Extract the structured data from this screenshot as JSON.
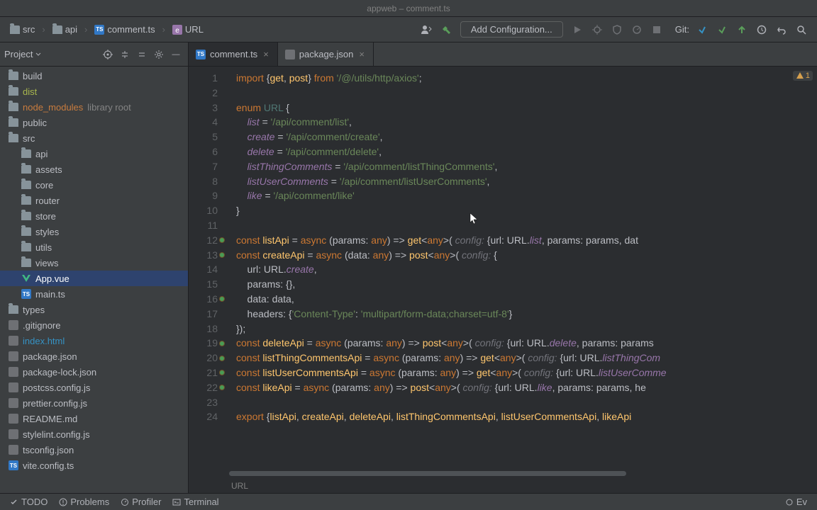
{
  "titlebar": "appweb – comment.ts",
  "breadcrumb": [
    {
      "label": "src",
      "icon": "folder"
    },
    {
      "label": "api",
      "icon": "folder"
    },
    {
      "label": "comment.ts",
      "icon": "ts"
    },
    {
      "label": "URL",
      "icon": "enum"
    }
  ],
  "config_label": "Add Configuration...",
  "git_label": "Git:",
  "project": {
    "title": "Project",
    "items": [
      {
        "label": "build",
        "icon": "folder",
        "indent": 0
      },
      {
        "label": "dist",
        "icon": "folder",
        "indent": 0,
        "cls": "olive"
      },
      {
        "label": "node_modules",
        "suffix": "library root",
        "icon": "folder",
        "indent": 0,
        "cls": "orange-txt"
      },
      {
        "label": "public",
        "icon": "folder",
        "indent": 0
      },
      {
        "label": "src",
        "icon": "folder",
        "indent": 0
      },
      {
        "label": "api",
        "icon": "folder",
        "indent": 1
      },
      {
        "label": "assets",
        "icon": "folder",
        "indent": 1
      },
      {
        "label": "core",
        "icon": "folder",
        "indent": 1
      },
      {
        "label": "router",
        "icon": "folder",
        "indent": 1
      },
      {
        "label": "store",
        "icon": "folder",
        "indent": 1
      },
      {
        "label": "styles",
        "icon": "folder",
        "indent": 1
      },
      {
        "label": "utils",
        "icon": "folder",
        "indent": 1
      },
      {
        "label": "views",
        "icon": "folder",
        "indent": 1
      },
      {
        "label": "App.vue",
        "icon": "vue",
        "indent": 1,
        "selected": true
      },
      {
        "label": "main.ts",
        "icon": "ts",
        "indent": 1
      },
      {
        "label": "types",
        "icon": "folder",
        "indent": 0
      },
      {
        "label": ".gitignore",
        "icon": "file",
        "indent": 0
      },
      {
        "label": "index.html",
        "icon": "file",
        "indent": 0,
        "cls": "blue"
      },
      {
        "label": "package.json",
        "icon": "json",
        "indent": 0
      },
      {
        "label": "package-lock.json",
        "icon": "json",
        "indent": 0
      },
      {
        "label": "postcss.config.js",
        "icon": "file",
        "indent": 0
      },
      {
        "label": "prettier.config.js",
        "icon": "file",
        "indent": 0
      },
      {
        "label": "README.md",
        "icon": "file",
        "indent": 0
      },
      {
        "label": "stylelint.config.js",
        "icon": "file",
        "indent": 0
      },
      {
        "label": "tsconfig.json",
        "icon": "json",
        "indent": 0
      },
      {
        "label": "vite.config.ts",
        "icon": "ts",
        "indent": 0
      }
    ]
  },
  "tabs": [
    {
      "label": "comment.ts",
      "icon": "ts",
      "active": true
    },
    {
      "label": "package.json",
      "icon": "json",
      "active": false
    }
  ],
  "warning_count": "1",
  "editor_status": "URL",
  "bottombar": {
    "left": [
      "TODO",
      "Problems",
      "Profiler",
      "Terminal"
    ],
    "right": [
      "Event Log"
    ]
  },
  "gutter_marks": {
    "12": true,
    "13": true,
    "16": true,
    "19": true,
    "20": true,
    "21": true,
    "22": true
  },
  "lines": 24
}
